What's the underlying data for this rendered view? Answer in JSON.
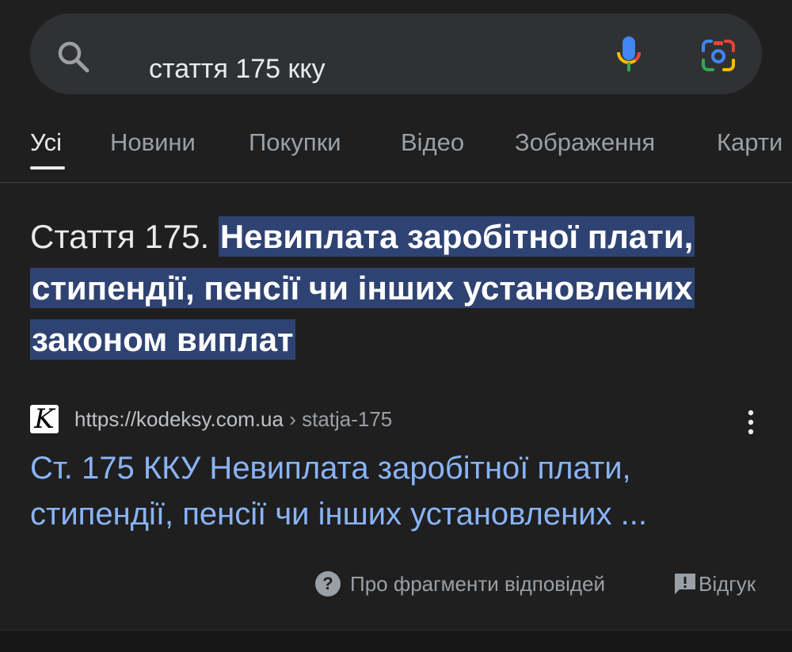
{
  "search": {
    "query": "стаття 175 кку",
    "icons": {
      "search": "search-icon",
      "mic": "mic-icon",
      "lens": "lens-icon"
    }
  },
  "tabs": [
    {
      "label": "Усі",
      "active": true
    },
    {
      "label": "Новини"
    },
    {
      "label": "Покупки"
    },
    {
      "label": "Відео"
    },
    {
      "label": "Зображення"
    },
    {
      "label": "Карти"
    }
  ],
  "snippet": {
    "prefix": "Стаття 175. ",
    "highlight": "Невиплата заробітної плати, стипендії, пенсії чи інших установлених законом виплат"
  },
  "result": {
    "favicon_letter": "K",
    "url": "https://kodeksy.com.ua",
    "breadcrumb": " › statja-175",
    "title": "Ст. 175 ККУ Невиплата заробітної плати, стипендії, пенсії чи інших установлених ..."
  },
  "footer": {
    "about": "Про фрагменти відповідей",
    "feedback": "Відгук"
  },
  "colors": {
    "background": "#1f1f1f",
    "search_bar": "#303134",
    "highlight": "#2f4373",
    "link": "#8ab4f8",
    "muted": "#9aa0a6"
  }
}
